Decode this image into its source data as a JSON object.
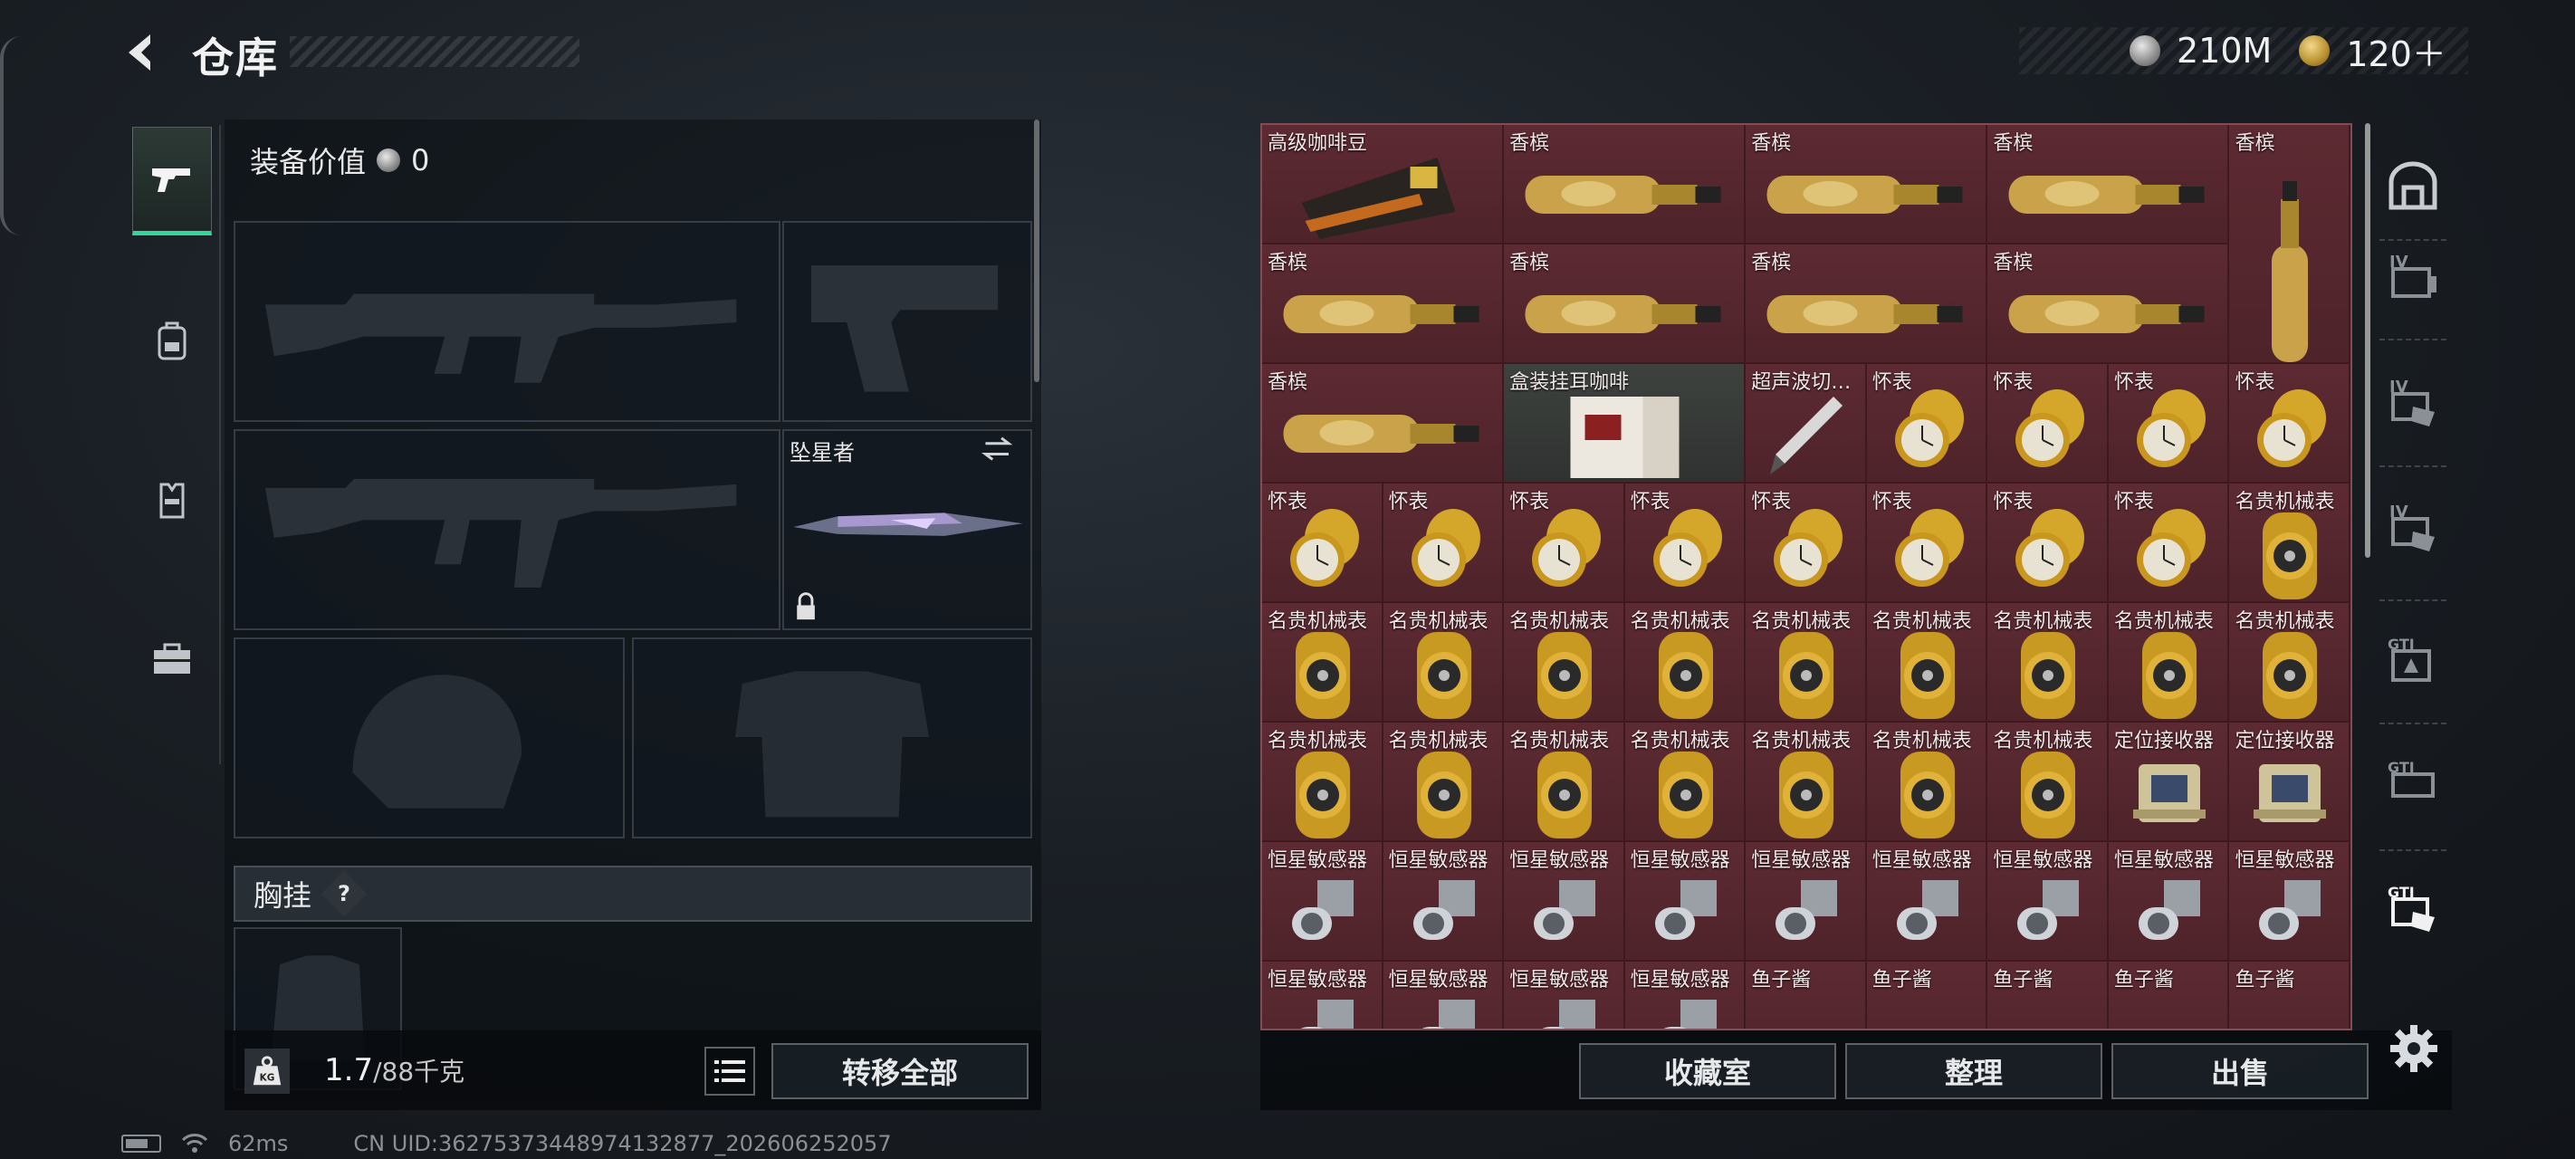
{
  "header": {
    "title": "仓库",
    "currencies": [
      {
        "icon": "silver-coin-icon",
        "value": "210M"
      },
      {
        "icon": "gold-coin-icon",
        "value": "120＋"
      }
    ]
  },
  "left_nav": {
    "items": [
      {
        "icon": "pistol-icon",
        "active": true
      },
      {
        "icon": "backpack-icon",
        "active": false
      },
      {
        "icon": "vest-icon",
        "active": false
      },
      {
        "icon": "toolbox-icon",
        "active": false
      }
    ]
  },
  "equipment": {
    "value_label": "装备价值",
    "value": "0",
    "melee_label": "坠星者",
    "chest_label": "胸挂",
    "chest_help": "?"
  },
  "weight": {
    "current": "1.7",
    "capacity": "/88千克",
    "transfer_all": "转移全部"
  },
  "inventory": {
    "items": [
      {
        "name": "高级咖啡豆",
        "type": "coffee"
      },
      {
        "name": "香槟",
        "type": "champagne"
      },
      {
        "name": "香槟",
        "type": "champagne"
      },
      {
        "name": "香槟",
        "type": "champagne"
      },
      {
        "name": "香槟",
        "type": "champagne-vertical"
      },
      {
        "name": "香槟",
        "type": "champagne"
      },
      {
        "name": "香槟",
        "type": "champagne"
      },
      {
        "name": "香槟",
        "type": "champagne"
      },
      {
        "name": "香槟",
        "type": "champagne"
      },
      {
        "name": "香槟",
        "type": "champagne"
      },
      {
        "name": "盒装挂耳咖啡",
        "type": "coffee-box"
      },
      {
        "name": "超声波切…",
        "type": "scalpel"
      },
      {
        "name": "怀表",
        "type": "pocketwatch"
      },
      {
        "name": "怀表",
        "type": "pocketwatch"
      },
      {
        "name": "怀表",
        "type": "pocketwatch"
      },
      {
        "name": "怀表",
        "type": "pocketwatch"
      },
      {
        "name": "怀表",
        "type": "pocketwatch"
      },
      {
        "name": "怀表",
        "type": "pocketwatch"
      },
      {
        "name": "怀表",
        "type": "pocketwatch"
      },
      {
        "name": "怀表",
        "type": "pocketwatch"
      },
      {
        "name": "怀表",
        "type": "pocketwatch"
      },
      {
        "name": "怀表",
        "type": "pocketwatch"
      },
      {
        "name": "怀表",
        "type": "pocketwatch"
      },
      {
        "name": "怀表",
        "type": "pocketwatch"
      },
      {
        "name": "名贵机械表",
        "type": "wristwatch"
      },
      {
        "name": "名贵机械表",
        "type": "wristwatch"
      },
      {
        "name": "名贵机械表",
        "type": "wristwatch"
      },
      {
        "name": "名贵机械表",
        "type": "wristwatch"
      },
      {
        "name": "名贵机械表",
        "type": "wristwatch"
      },
      {
        "name": "名贵机械表",
        "type": "wristwatch"
      },
      {
        "name": "名贵机械表",
        "type": "wristwatch"
      },
      {
        "name": "名贵机械表",
        "type": "wristwatch"
      },
      {
        "name": "名贵机械表",
        "type": "wristwatch"
      },
      {
        "name": "名贵机械表",
        "type": "wristwatch"
      },
      {
        "name": "名贵机械表",
        "type": "wristwatch"
      },
      {
        "name": "名贵机械表",
        "type": "wristwatch"
      },
      {
        "name": "名贵机械表",
        "type": "wristwatch"
      },
      {
        "name": "名贵机械表",
        "type": "wristwatch"
      },
      {
        "name": "名贵机械表",
        "type": "wristwatch"
      },
      {
        "name": "名贵机械表",
        "type": "wristwatch"
      },
      {
        "name": "名贵机械表",
        "type": "wristwatch"
      },
      {
        "name": "定位接收器",
        "type": "receiver"
      },
      {
        "name": "定位接收器",
        "type": "receiver"
      },
      {
        "name": "恒星敏感器",
        "type": "sensor"
      },
      {
        "name": "恒星敏感器",
        "type": "sensor"
      },
      {
        "name": "恒星敏感器",
        "type": "sensor"
      },
      {
        "name": "恒星敏感器",
        "type": "sensor"
      },
      {
        "name": "恒星敏感器",
        "type": "sensor"
      },
      {
        "name": "恒星敏感器",
        "type": "sensor"
      },
      {
        "name": "恒星敏感器",
        "type": "sensor"
      },
      {
        "name": "恒星敏感器",
        "type": "sensor"
      },
      {
        "name": "恒星敏感器",
        "type": "sensor"
      },
      {
        "name": "恒星敏感器",
        "type": "sensor"
      },
      {
        "name": "恒星敏感器",
        "type": "sensor"
      },
      {
        "name": "恒星敏感器",
        "type": "sensor"
      },
      {
        "name": "恒星敏感器",
        "type": "sensor"
      },
      {
        "name": "鱼子酱",
        "type": "caviar"
      },
      {
        "name": "鱼子酱",
        "type": "caviar"
      },
      {
        "name": "鱼子酱",
        "type": "caviar"
      },
      {
        "name": "鱼子酱",
        "type": "caviar"
      },
      {
        "name": "鱼子酱",
        "type": "caviar"
      }
    ]
  },
  "right_nav": {
    "items": [
      {
        "icon": "container-icon"
      },
      {
        "icon": "case-iv-icon"
      },
      {
        "icon": "case-iv-hand-icon"
      },
      {
        "icon": "case-iv-hand-icon"
      },
      {
        "icon": "case-gti-icon"
      },
      {
        "icon": "case-gti-icon"
      },
      {
        "icon": "case-gti-hand-icon"
      }
    ]
  },
  "actions": {
    "collection": "收藏室",
    "sort": "整理",
    "sell": "出售"
  },
  "status": {
    "ping": "62ms",
    "uid": "CN UID:36275373448974132877_202606252057"
  },
  "colors": {
    "accent_green": "#36d69a",
    "inventory_bg": "#6b2e36"
  }
}
